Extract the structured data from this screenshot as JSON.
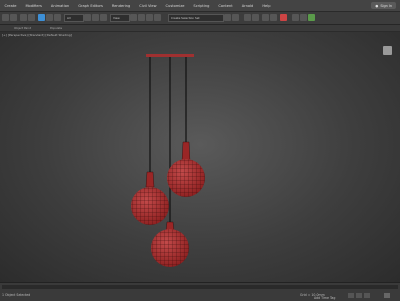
{
  "menu": [
    "Create",
    "Modifiers",
    "Animation",
    "Graph Editors",
    "Rendering",
    "Civil View",
    "Customize",
    "Scripting",
    "Content",
    "Arnold",
    "Help"
  ],
  "signin": "Sign In",
  "toolbar": {
    "dropdown_a": "All",
    "dropdown_b": "View",
    "dropdown_c": "Create Selection Set"
  },
  "subbar": {
    "left": "Object Paint",
    "right": "Populate"
  },
  "viewport": {
    "label": "[+] [Perspective] [Standard] [Default Shading]"
  },
  "status": {
    "left": "1 Object Selected",
    "right": "Add Time Tag",
    "grid": "Grid = 10.0mm"
  }
}
